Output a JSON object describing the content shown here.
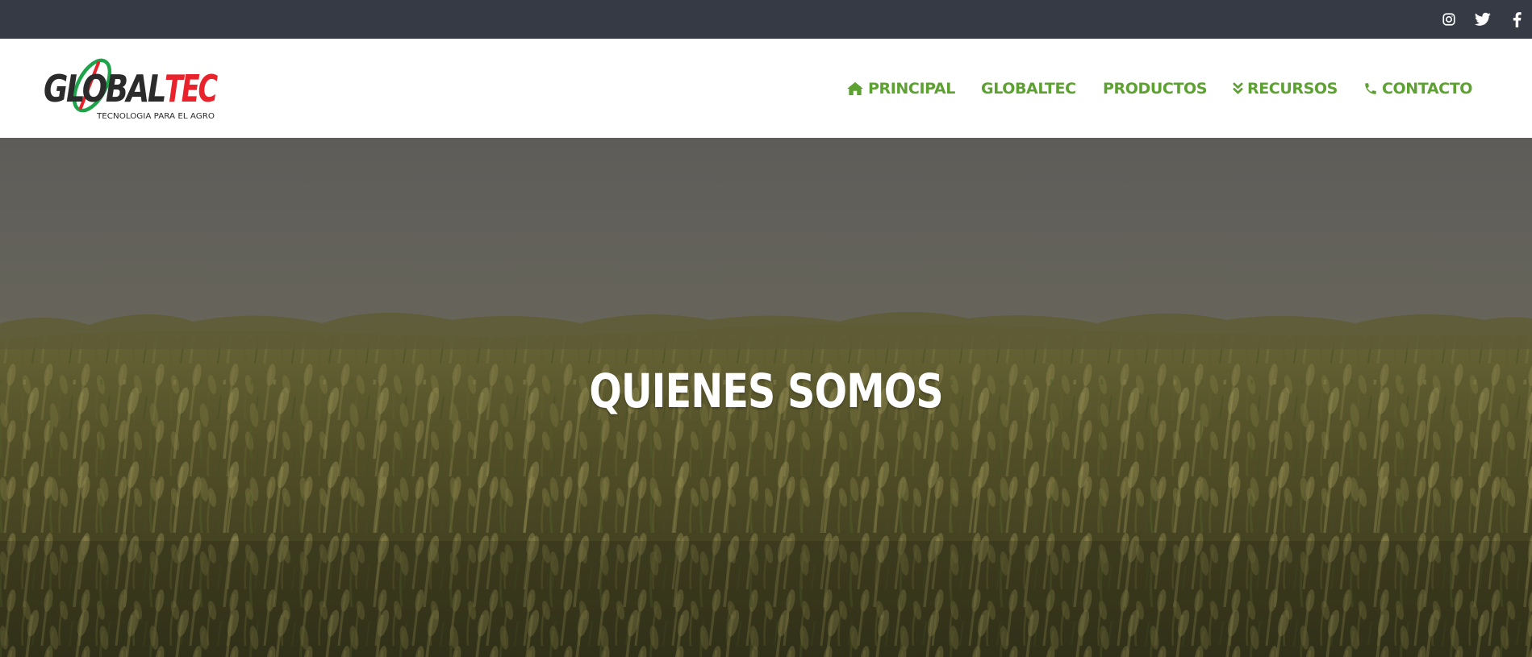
{
  "topbar": {
    "background": "#353a45",
    "social": [
      {
        "name": "instagram-icon"
      },
      {
        "name": "twitter-icon"
      },
      {
        "name": "facebook-icon"
      }
    ]
  },
  "logo": {
    "brand_dark": "GLOBAL",
    "brand_accent": "TEC",
    "tagline": "TECNOLOGIA PARA EL AGRO",
    "colors": {
      "dark": "#2b2b2b",
      "accent": "#e8232b",
      "swoosh": "#1fa34a"
    }
  },
  "nav": {
    "accent": "#5ea133",
    "items": [
      {
        "label": "PRINCIPAL",
        "icon": "home-icon"
      },
      {
        "label": "GLOBALTEC",
        "icon": ""
      },
      {
        "label": "PRODUCTOS",
        "icon": ""
      },
      {
        "label": "RECURSOS",
        "icon": "double-chevron-down-icon"
      },
      {
        "label": "CONTACTO",
        "icon": "phone-icon"
      }
    ]
  },
  "hero": {
    "title": "QUIENES SOMOS",
    "image": "wheat-field"
  }
}
